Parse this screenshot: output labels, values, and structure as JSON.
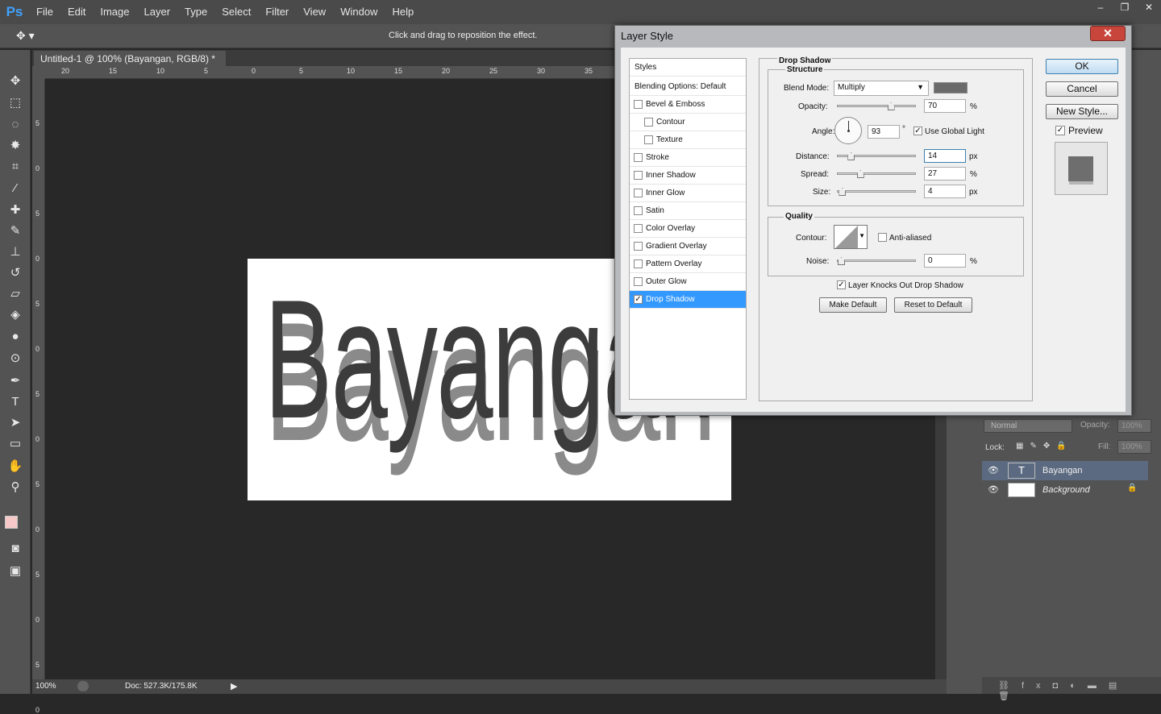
{
  "app": {
    "logo": "Ps"
  },
  "menu": [
    "File",
    "Edit",
    "Image",
    "Layer",
    "Type",
    "Select",
    "Filter",
    "View",
    "Window",
    "Help"
  ],
  "window_controls": {
    "minimize": "–",
    "restore": "❐",
    "close": "✕"
  },
  "options_bar": {
    "hint": "Click and drag to reposition the effect."
  },
  "document": {
    "tab_title": "Untitled-1 @ 100% (Bayangan, RGB/8) *",
    "tab_close": "×",
    "canvas_text": "Bayangan",
    "zoom": "100%",
    "doc_size": "Doc: 527.3K/175.8K"
  },
  "ruler_h": [
    "20",
    "15",
    "10",
    "5",
    "0",
    "5",
    "10",
    "15",
    "20",
    "25",
    "30",
    "35"
  ],
  "ruler_v": [
    "5",
    "0",
    "5",
    "0",
    "5",
    "0",
    "5",
    "0",
    "5",
    "0",
    "5",
    "0",
    "5",
    "0"
  ],
  "dialog": {
    "title": "Layer Style",
    "styles_header": "Styles",
    "blending": "Blending Options: Default",
    "items": [
      {
        "label": "Bevel & Emboss",
        "checked": false,
        "sub": false
      },
      {
        "label": "Contour",
        "checked": false,
        "sub": true
      },
      {
        "label": "Texture",
        "checked": false,
        "sub": true
      },
      {
        "label": "Stroke",
        "checked": false,
        "sub": false
      },
      {
        "label": "Inner Shadow",
        "checked": false,
        "sub": false
      },
      {
        "label": "Inner Glow",
        "checked": false,
        "sub": false
      },
      {
        "label": "Satin",
        "checked": false,
        "sub": false
      },
      {
        "label": "Color Overlay",
        "checked": false,
        "sub": false
      },
      {
        "label": "Gradient Overlay",
        "checked": false,
        "sub": false
      },
      {
        "label": "Pattern Overlay",
        "checked": false,
        "sub": false
      },
      {
        "label": "Outer Glow",
        "checked": false,
        "sub": false
      },
      {
        "label": "Drop Shadow",
        "checked": true,
        "sub": false,
        "selected": true
      }
    ],
    "drop_shadow": {
      "title": "Drop Shadow",
      "structure": "Structure",
      "blend_mode_label": "Blend Mode:",
      "blend_mode": "Multiply",
      "shadow_color": "#6a6a6a",
      "opacity_label": "Opacity:",
      "opacity": "70",
      "angle_label": "Angle:",
      "angle": "93",
      "degree": "°",
      "use_global_light": "Use Global Light",
      "distance_label": "Distance:",
      "distance": "14",
      "spread_label": "Spread:",
      "spread": "27",
      "size_label": "Size:",
      "size": "4",
      "quality": "Quality",
      "contour_label": "Contour:",
      "anti_aliased": "Anti-aliased",
      "noise_label": "Noise:",
      "noise": "0",
      "knocks_out": "Layer Knocks Out Drop Shadow",
      "make_default": "Make Default",
      "reset_default": "Reset to Default",
      "unit_pct": "%",
      "unit_px": "px"
    },
    "ok": "OK",
    "cancel": "Cancel",
    "new_style": "New Style...",
    "preview": "Preview"
  },
  "layers": {
    "blend": "Normal",
    "opacity_label": "Opacity:",
    "opacity": "100%",
    "lock_label": "Lock:",
    "fill_label": "Fill:",
    "fill": "100%",
    "rows": [
      {
        "name": "Bayangan",
        "thumb": "T"
      },
      {
        "name": "Background"
      }
    ]
  }
}
